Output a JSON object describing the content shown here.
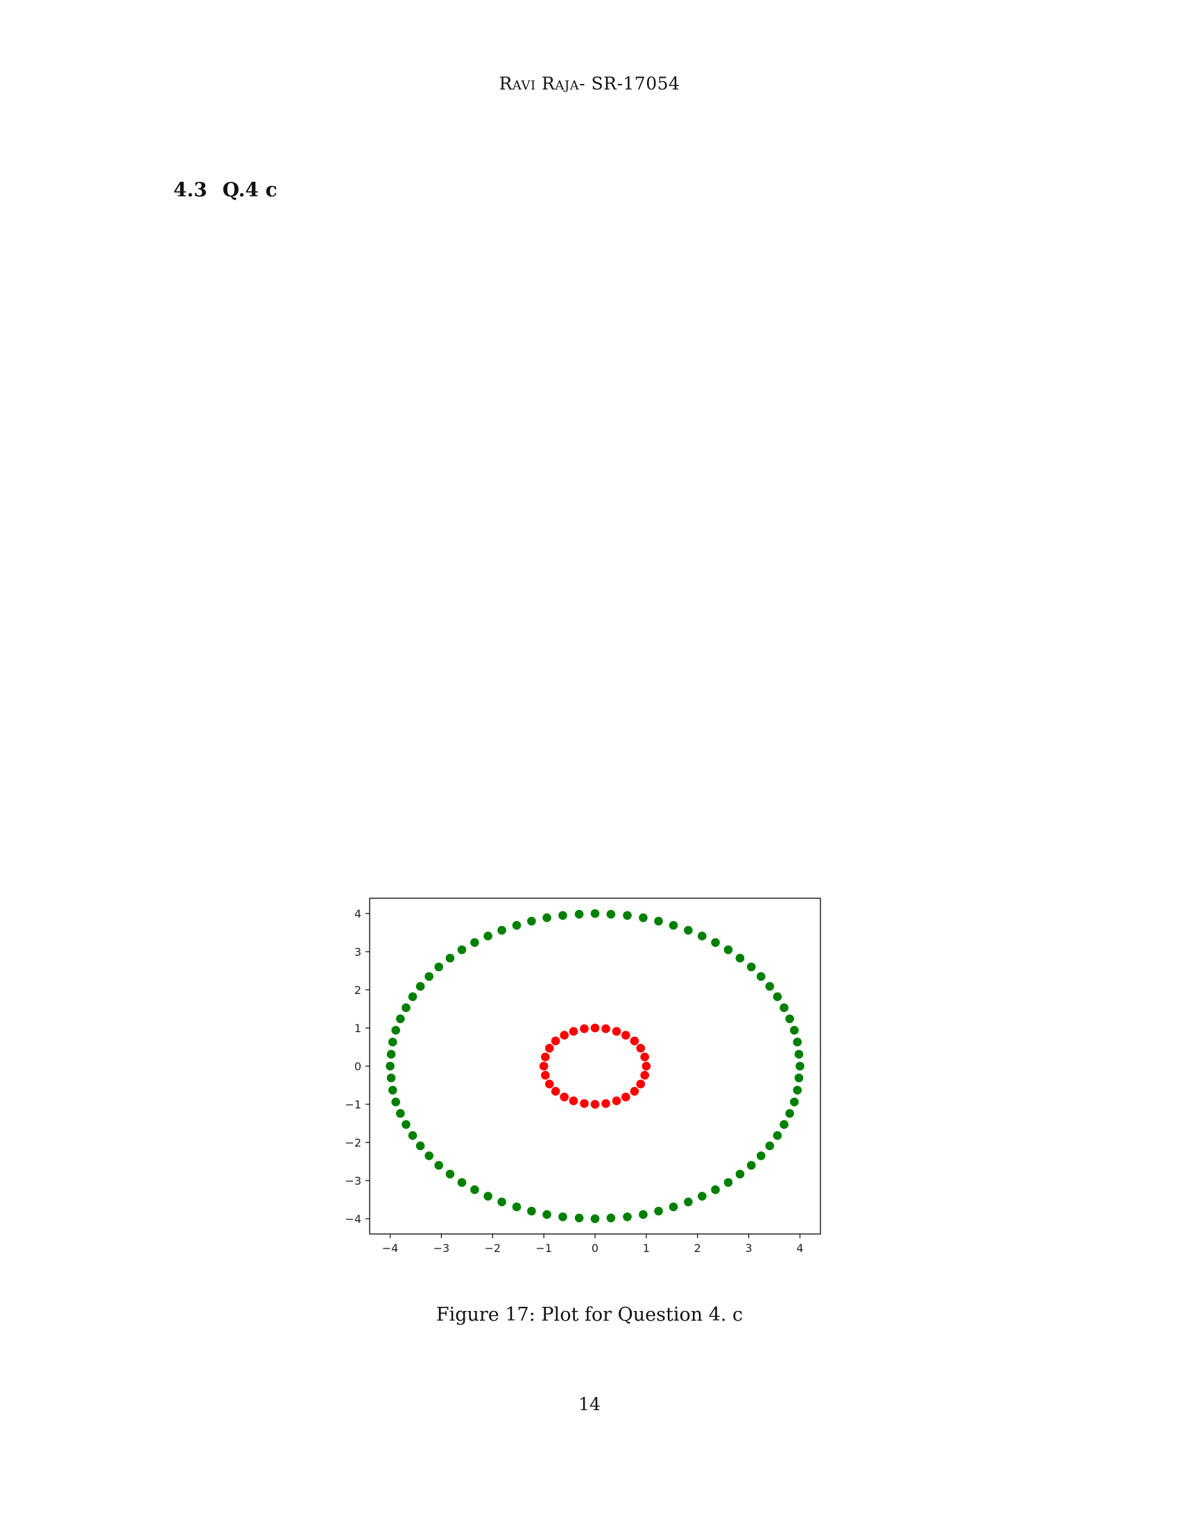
{
  "header": {
    "running_head": "Ravi Raja- SR-17054"
  },
  "section": {
    "number": "4.3",
    "title": "Q.4 c"
  },
  "figure": {
    "caption": "Figure 17: Plot for Question 4. c"
  },
  "page": {
    "number": "14"
  },
  "chart_data": {
    "type": "scatter",
    "title": "",
    "xlabel": "",
    "ylabel": "",
    "xlim": [
      -4.4,
      4.4
    ],
    "ylim": [
      -4.4,
      4.4
    ],
    "x_ticks": [
      "−4",
      "−3",
      "−2",
      "−1",
      "0",
      "1",
      "2",
      "3",
      "4"
    ],
    "y_ticks": [
      "−4",
      "−3",
      "−2",
      "−1",
      "0",
      "1",
      "2",
      "3",
      "4"
    ],
    "grid": false,
    "series": [
      {
        "color": "#008000",
        "points": [
          [
            4.0,
            0.0
          ],
          [
            3.98,
            0.31
          ],
          [
            3.95,
            0.63
          ],
          [
            3.89,
            0.94
          ],
          [
            3.8,
            1.24
          ],
          [
            3.69,
            1.53
          ],
          [
            3.56,
            1.82
          ],
          [
            3.41,
            2.09
          ],
          [
            3.24,
            2.35
          ],
          [
            3.05,
            2.6
          ],
          [
            2.83,
            2.83
          ],
          [
            2.6,
            3.05
          ],
          [
            2.35,
            3.24
          ],
          [
            2.09,
            3.41
          ],
          [
            1.82,
            3.56
          ],
          [
            1.53,
            3.69
          ],
          [
            1.24,
            3.8
          ],
          [
            0.94,
            3.89
          ],
          [
            0.63,
            3.95
          ],
          [
            0.31,
            3.98
          ],
          [
            0.0,
            4.0
          ],
          [
            -0.31,
            3.98
          ],
          [
            -0.63,
            3.95
          ],
          [
            -0.94,
            3.89
          ],
          [
            -1.24,
            3.8
          ],
          [
            -1.53,
            3.69
          ],
          [
            -1.82,
            3.56
          ],
          [
            -2.09,
            3.41
          ],
          [
            -2.35,
            3.24
          ],
          [
            -2.6,
            3.05
          ],
          [
            -2.83,
            2.83
          ],
          [
            -3.05,
            2.6
          ],
          [
            -3.24,
            2.35
          ],
          [
            -3.41,
            2.09
          ],
          [
            -3.56,
            1.82
          ],
          [
            -3.69,
            1.53
          ],
          [
            -3.8,
            1.24
          ],
          [
            -3.89,
            0.94
          ],
          [
            -3.95,
            0.63
          ],
          [
            -3.98,
            0.31
          ],
          [
            -4.0,
            0.0
          ],
          [
            -3.98,
            -0.31
          ],
          [
            -3.95,
            -0.63
          ],
          [
            -3.89,
            -0.94
          ],
          [
            -3.8,
            -1.24
          ],
          [
            -3.69,
            -1.53
          ],
          [
            -3.56,
            -1.82
          ],
          [
            -3.41,
            -2.09
          ],
          [
            -3.24,
            -2.35
          ],
          [
            -3.05,
            -2.6
          ],
          [
            -2.83,
            -2.83
          ],
          [
            -2.6,
            -3.05
          ],
          [
            -2.35,
            -3.24
          ],
          [
            -2.09,
            -3.41
          ],
          [
            -1.82,
            -3.56
          ],
          [
            -1.53,
            -3.69
          ],
          [
            -1.24,
            -3.8
          ],
          [
            -0.94,
            -3.89
          ],
          [
            -0.63,
            -3.95
          ],
          [
            -0.31,
            -3.98
          ],
          [
            0.0,
            -4.0
          ],
          [
            0.31,
            -3.98
          ],
          [
            0.63,
            -3.95
          ],
          [
            0.94,
            -3.89
          ],
          [
            1.24,
            -3.8
          ],
          [
            1.53,
            -3.69
          ],
          [
            1.82,
            -3.56
          ],
          [
            2.09,
            -3.41
          ],
          [
            2.35,
            -3.24
          ],
          [
            2.6,
            -3.05
          ],
          [
            2.83,
            -2.83
          ],
          [
            3.05,
            -2.6
          ],
          [
            3.24,
            -2.35
          ],
          [
            3.41,
            -2.09
          ],
          [
            3.56,
            -1.82
          ],
          [
            3.69,
            -1.53
          ],
          [
            3.8,
            -1.24
          ],
          [
            3.89,
            -0.94
          ],
          [
            3.95,
            -0.63
          ],
          [
            3.98,
            -0.31
          ]
        ]
      },
      {
        "color": "#ff0000",
        "points": [
          [
            1.0,
            0.0
          ],
          [
            0.97,
            0.24
          ],
          [
            0.89,
            0.47
          ],
          [
            0.77,
            0.66
          ],
          [
            0.6,
            0.81
          ],
          [
            0.42,
            0.91
          ],
          [
            0.21,
            0.98
          ],
          [
            0.0,
            1.0
          ],
          [
            -0.21,
            0.98
          ],
          [
            -0.42,
            0.91
          ],
          [
            -0.6,
            0.81
          ],
          [
            -0.77,
            0.66
          ],
          [
            -0.89,
            0.47
          ],
          [
            -0.97,
            0.24
          ],
          [
            -1.0,
            0.0
          ],
          [
            -0.97,
            -0.24
          ],
          [
            -0.89,
            -0.47
          ],
          [
            -0.77,
            -0.66
          ],
          [
            -0.6,
            -0.81
          ],
          [
            -0.42,
            -0.91
          ],
          [
            -0.21,
            -0.98
          ],
          [
            0.0,
            -1.0
          ],
          [
            0.21,
            -0.98
          ],
          [
            0.42,
            -0.91
          ],
          [
            0.6,
            -0.81
          ],
          [
            0.77,
            -0.66
          ],
          [
            0.89,
            -0.47
          ],
          [
            0.97,
            -0.24
          ]
        ]
      }
    ]
  }
}
